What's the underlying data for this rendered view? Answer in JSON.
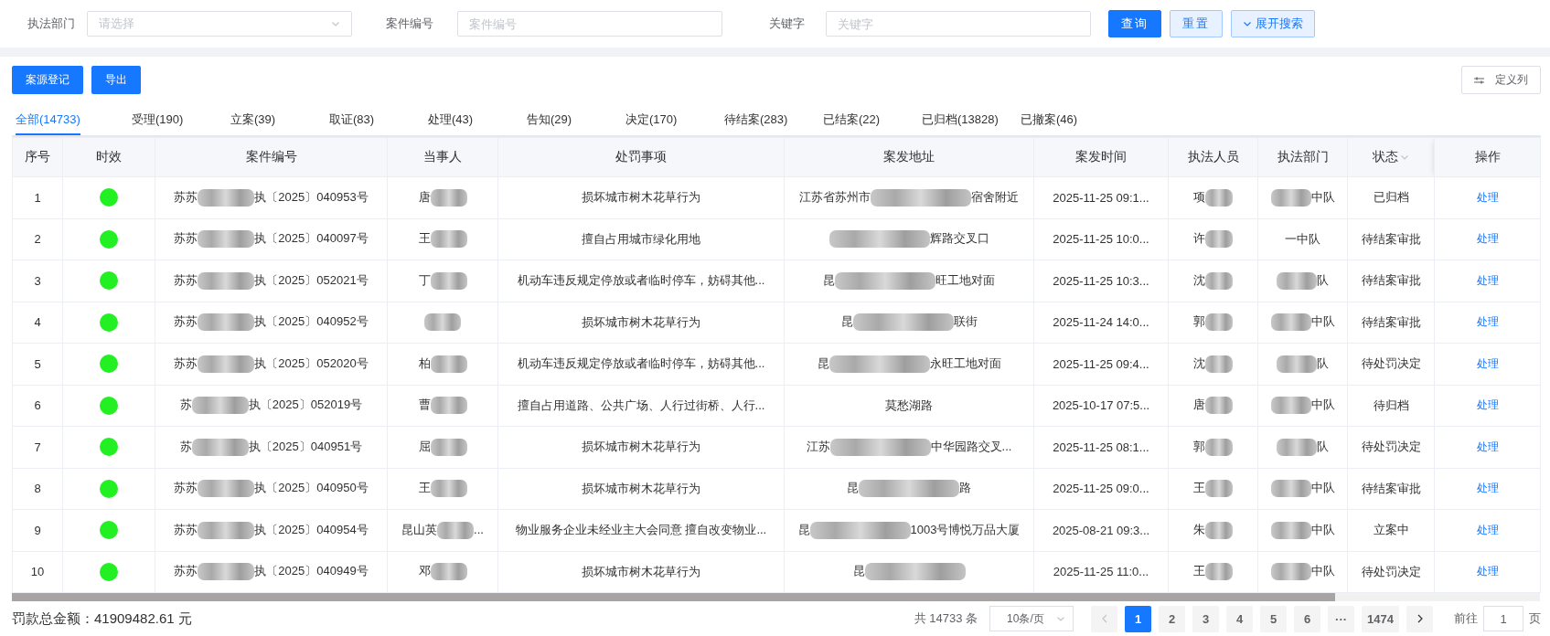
{
  "filters": [
    {
      "label": "执法部门",
      "placeholder": "请选择",
      "kind": "select"
    },
    {
      "label": "案件编号",
      "placeholder": "案件编号",
      "kind": "text"
    },
    {
      "label": "关键字",
      "placeholder": "关键字",
      "kind": "text"
    }
  ],
  "search_buttons": [
    {
      "label": "查询",
      "kind": "primary"
    },
    {
      "label": "重置",
      "kind": "plain"
    },
    {
      "label": "展开搜索",
      "kind": "expand"
    }
  ],
  "actions": [
    {
      "label": "案源登记"
    },
    {
      "label": "导出"
    }
  ],
  "column_settings": {
    "label": "定义列"
  },
  "tabs": [
    {
      "label": "全部(14733)",
      "selected": true
    },
    {
      "label": "受理(190)",
      "selected": false
    },
    {
      "label": "立案(39)",
      "selected": false
    },
    {
      "label": "取证(83)",
      "selected": false
    },
    {
      "label": "处理(43)",
      "selected": false
    },
    {
      "label": "告知(29)",
      "selected": false
    },
    {
      "label": "决定(170)",
      "selected": false
    },
    {
      "label": "待结案(283)",
      "selected": false
    },
    {
      "label": "已结案(22)",
      "selected": false
    },
    {
      "label": "已归档(13828)",
      "selected": false
    },
    {
      "label": "已撤案(46)",
      "selected": false
    }
  ],
  "table": {
    "columns": [
      {
        "label": "序号",
        "sortable": false
      },
      {
        "label": "时效",
        "sortable": false
      },
      {
        "label": "案件编号",
        "sortable": false
      },
      {
        "label": "当事人",
        "sortable": false
      },
      {
        "label": "处罚事项",
        "sortable": false
      },
      {
        "label": "案发地址",
        "sortable": false
      },
      {
        "label": "案发时间",
        "sortable": false
      },
      {
        "label": "执法人员",
        "sortable": false
      },
      {
        "label": "执法部门",
        "sortable": false
      },
      {
        "label": "状态",
        "sortable": true
      },
      {
        "label": "操作",
        "sortable": false
      }
    ],
    "rows": [
      {
        "index": "1",
        "color": "#22f022",
        "case_no": {
          "kind": "redacted",
          "before": "苏苏",
          "after": "执〔2025〕040953号"
        },
        "party": {
          "kind": "redacted",
          "before": "唐"
        },
        "violation": "损坏城市树木花草行为",
        "address": {
          "kind": "redacted",
          "before": "江苏省苏州市",
          "after": "宿舍附近"
        },
        "time": "2025-11-25 09:1...",
        "officer": {
          "kind": "redacted",
          "before": "项"
        },
        "department": {
          "kind": "redacted",
          "after": "中队"
        },
        "status": "已归档",
        "action": "处理"
      },
      {
        "index": "2",
        "color": "#22f022",
        "case_no": {
          "kind": "redacted",
          "before": "苏苏",
          "after": "执〔2025〕040097号"
        },
        "party": {
          "kind": "redacted",
          "before": "王"
        },
        "violation": "擅自占用城市绿化用地",
        "address": {
          "kind": "redacted",
          "after": "辉路交叉口"
        },
        "time": "2025-11-25 10:0...",
        "officer": {
          "kind": "redacted",
          "before": "许"
        },
        "department": "一中队",
        "status": "待结案审批",
        "action": "处理"
      },
      {
        "index": "3",
        "color": "#22f022",
        "case_no": {
          "kind": "redacted",
          "before": "苏苏",
          "after": "执〔2025〕052021号"
        },
        "party": {
          "kind": "redacted",
          "before": "丁"
        },
        "violation": "机动车违反规定停放或者临时停车，妨碍其他...",
        "address": {
          "kind": "redacted",
          "before": "昆",
          "after": "旺工地对面"
        },
        "time": "2025-11-25 10:3...",
        "officer": {
          "kind": "redacted",
          "before": "沈"
        },
        "department": {
          "kind": "redacted",
          "after": "队"
        },
        "status": "待结案审批",
        "action": "处理"
      },
      {
        "index": "4",
        "color": "#22f022",
        "case_no": {
          "kind": "redacted",
          "before": "苏苏",
          "after": "执〔2025〕040952号"
        },
        "party": {
          "kind": "redacted"
        },
        "violation": "损坏城市树木花草行为",
        "address": {
          "kind": "redacted",
          "before": "昆",
          "after": "联街"
        },
        "time": "2025-11-24 14:0...",
        "officer": {
          "kind": "redacted",
          "before": "郭"
        },
        "department": {
          "kind": "redacted",
          "after": "中队"
        },
        "status": "待结案审批",
        "action": "处理"
      },
      {
        "index": "5",
        "color": "#22f022",
        "case_no": {
          "kind": "redacted",
          "before": "苏苏",
          "after": "执〔2025〕052020号"
        },
        "party": {
          "kind": "redacted",
          "before": "柏"
        },
        "violation": "机动车违反规定停放或者临时停车，妨碍其他...",
        "address": {
          "kind": "redacted",
          "before": "昆",
          "after": "永旺工地对面"
        },
        "time": "2025-11-25 09:4...",
        "officer": {
          "kind": "redacted",
          "before": "沈"
        },
        "department": {
          "kind": "redacted",
          "after": "队"
        },
        "status": "待处罚决定",
        "action": "处理"
      },
      {
        "index": "6",
        "color": "#22f022",
        "case_no": {
          "kind": "redacted",
          "before": "苏",
          "after": "执〔2025〕052019号"
        },
        "party": {
          "kind": "redacted",
          "before": "曹"
        },
        "violation": "擅自占用道路、公共广场、人行过街桥、人行...",
        "address": "莫愁湖路",
        "time": "2025-10-17 07:5...",
        "officer": {
          "kind": "redacted",
          "before": "唐"
        },
        "department": {
          "kind": "redacted",
          "after": "中队"
        },
        "status": "待归档",
        "action": "处理"
      },
      {
        "index": "7",
        "color": "#22f022",
        "case_no": {
          "kind": "redacted",
          "before": "苏",
          "after": "执〔2025〕040951号"
        },
        "party": {
          "kind": "redacted",
          "before": "屈"
        },
        "violation": "损坏城市树木花草行为",
        "address": {
          "kind": "redacted",
          "before": "江苏",
          "after": "中华园路交叉..."
        },
        "time": "2025-11-25 08:1...",
        "officer": {
          "kind": "redacted",
          "before": "郭"
        },
        "department": {
          "kind": "redacted",
          "after": "队"
        },
        "status": "待处罚决定",
        "action": "处理"
      },
      {
        "index": "8",
        "color": "#22f022",
        "case_no": {
          "kind": "redacted",
          "before": "苏苏",
          "after": "执〔2025〕040950号"
        },
        "party": {
          "kind": "redacted",
          "before": "王"
        },
        "violation": "损坏城市树木花草行为",
        "address": {
          "kind": "redacted",
          "before": "昆",
          "after": "路"
        },
        "time": "2025-11-25 09:0...",
        "officer": {
          "kind": "redacted",
          "before": "王"
        },
        "department": {
          "kind": "redacted",
          "after": "中队"
        },
        "status": "待结案审批",
        "action": "处理"
      },
      {
        "index": "9",
        "color": "#22f022",
        "case_no": {
          "kind": "redacted",
          "before": "苏苏",
          "after": "执〔2025〕040954号"
        },
        "party": {
          "kind": "redacted",
          "before": "昆山英",
          "after": "..."
        },
        "violation": "物业服务企业未经业主大会同意 擅自改变物业...",
        "address": {
          "kind": "redacted",
          "before": "昆",
          "after": "1003号博悦万品大厦"
        },
        "time": "2025-08-21 09:3...",
        "officer": {
          "kind": "redacted",
          "before": "朱"
        },
        "department": {
          "kind": "redacted",
          "after": "中队"
        },
        "status": "立案中",
        "action": "处理"
      },
      {
        "index": "10",
        "color": "#22f022",
        "case_no": {
          "kind": "redacted",
          "before": "苏苏",
          "after": "执〔2025〕040949号"
        },
        "party": {
          "kind": "redacted",
          "before": "邓"
        },
        "violation": "损坏城市树木花草行为",
        "address": {
          "kind": "redacted",
          "before": "昆"
        },
        "time": "2025-11-25 11:0...",
        "officer": {
          "kind": "redacted",
          "before": "王"
        },
        "department": {
          "kind": "redacted",
          "after": "中队"
        },
        "status": "待处罚决定",
        "action": "处理"
      }
    ]
  },
  "footer": {
    "fine_total": "罚款总金额：41909482.61 元",
    "total": "共 14733 条",
    "page_size": "10条/页",
    "pages": [
      {
        "label": "1",
        "selected": true
      },
      {
        "label": "2",
        "selected": false
      },
      {
        "label": "3",
        "selected": false
      },
      {
        "label": "4",
        "selected": false
      },
      {
        "label": "5",
        "selected": false
      },
      {
        "label": "6",
        "selected": false
      },
      {
        "label": "···",
        "selected": false
      },
      {
        "label": "1474",
        "selected": false
      }
    ],
    "goto_label": "前往",
    "goto_value": "1",
    "goto_suffix": "页"
  }
}
